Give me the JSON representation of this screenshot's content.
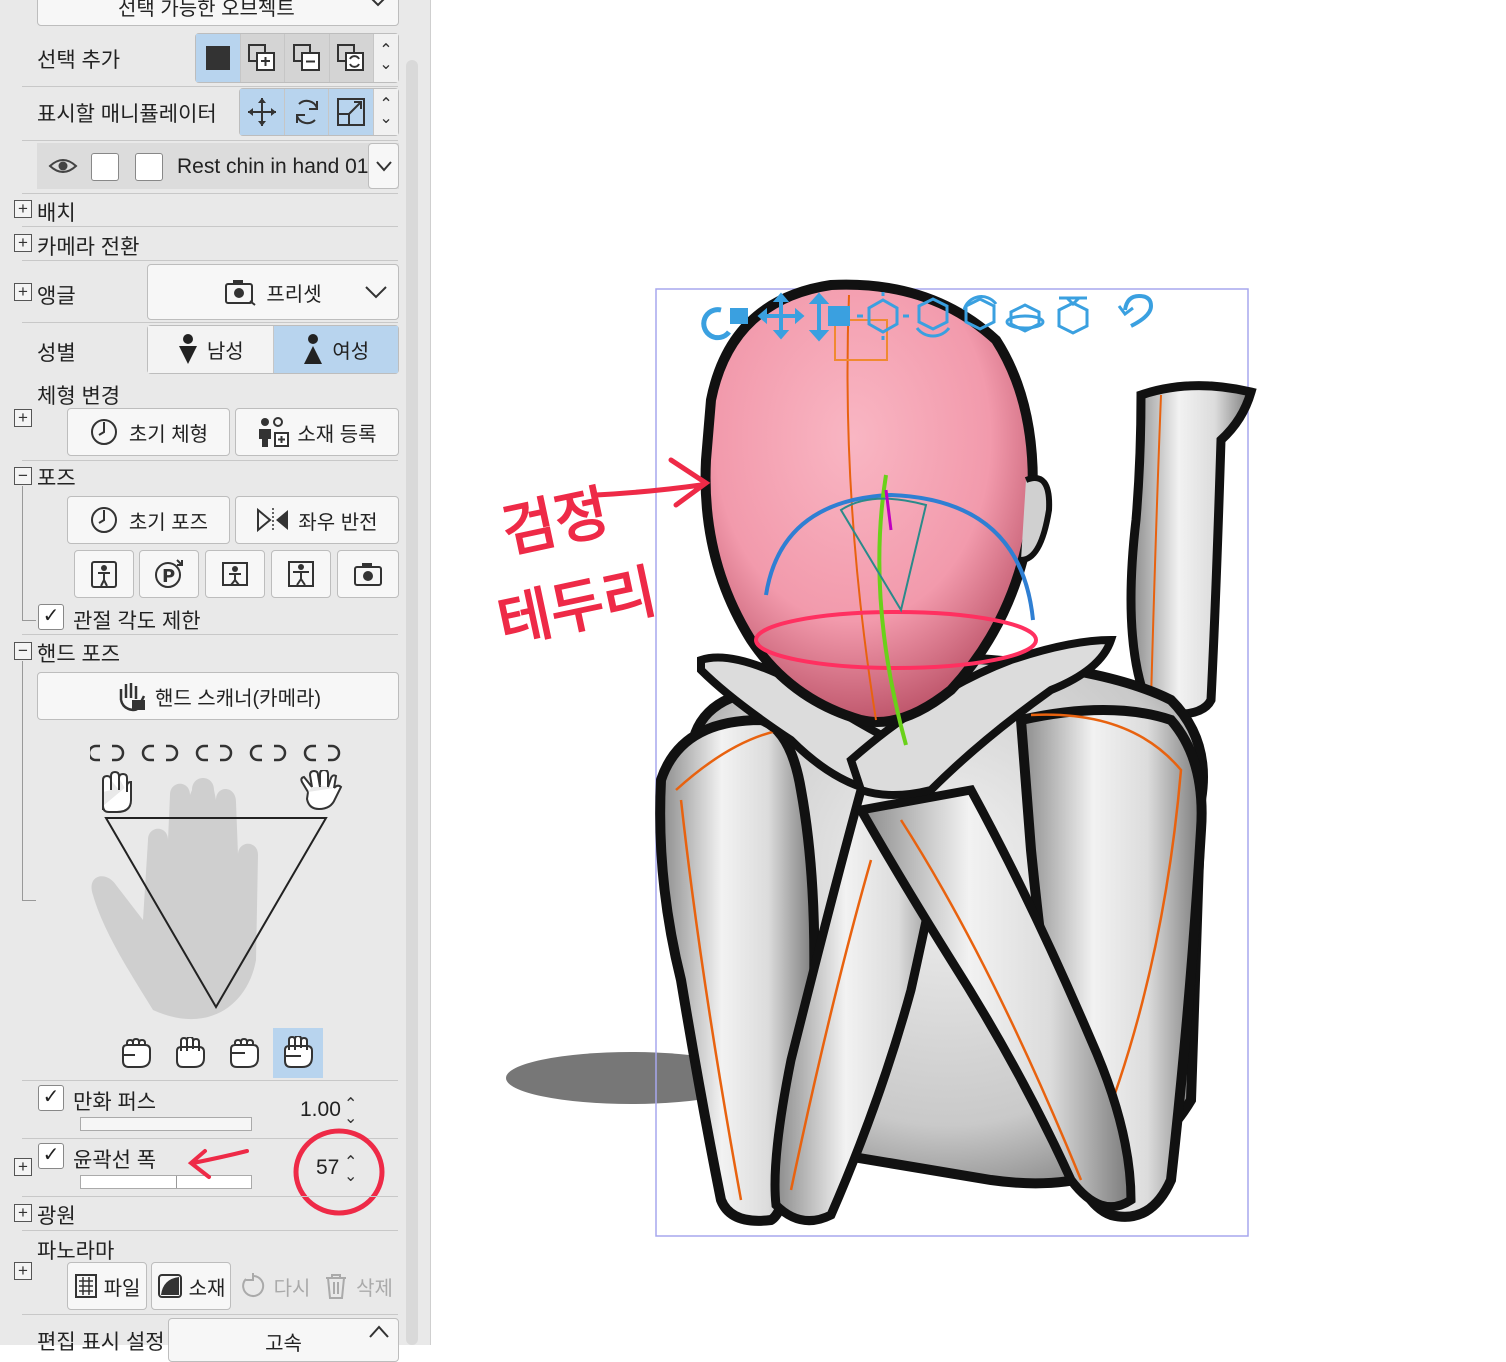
{
  "panel": {
    "top_dropdown": "선택 가능한 오브젝트",
    "add_selection_label": "선택 추가",
    "manipulator_label": "표시할 매니퓰레이터",
    "object_name": "Rest chin in hand 01",
    "placement": "배치",
    "camera_switch": "카메라 전환",
    "angle_label": "앵글",
    "angle_preset": "프리셋",
    "gender_label": "성별",
    "gender_male": "남성",
    "gender_female": "여성",
    "body_change": "체형 변경",
    "initial_body": "초기 체형",
    "register_material": "소재 등록",
    "pose_label": "포즈",
    "initial_pose": "초기 포즈",
    "flip_lr": "좌우 반전",
    "joint_limit": "관절 각도 제한",
    "hand_pose": "핸드 포즈",
    "hand_scanner": "핸드 스캐너(카메라)",
    "manga_perspective": "만화 퍼스",
    "manga_perspective_value": "1.00",
    "outline_width": "윤곽선 폭",
    "outline_width_value": "57",
    "light_source": "광원",
    "panorama": "파노라마",
    "pano_file": "파일",
    "pano_material": "소재",
    "pano_redo": "다시",
    "pano_delete": "삭제",
    "edit_display": "편집 표시 설정",
    "edit_display_value": "고속"
  },
  "annotations": {
    "canvas_note_line1": "검정",
    "canvas_note_line2": "테두리",
    "accent_red": "#ee2a47"
  },
  "colors": {
    "selected": "#b8d4ee",
    "manipulator_blue": "#3aa0e0",
    "head_pink": "#f29aac"
  }
}
